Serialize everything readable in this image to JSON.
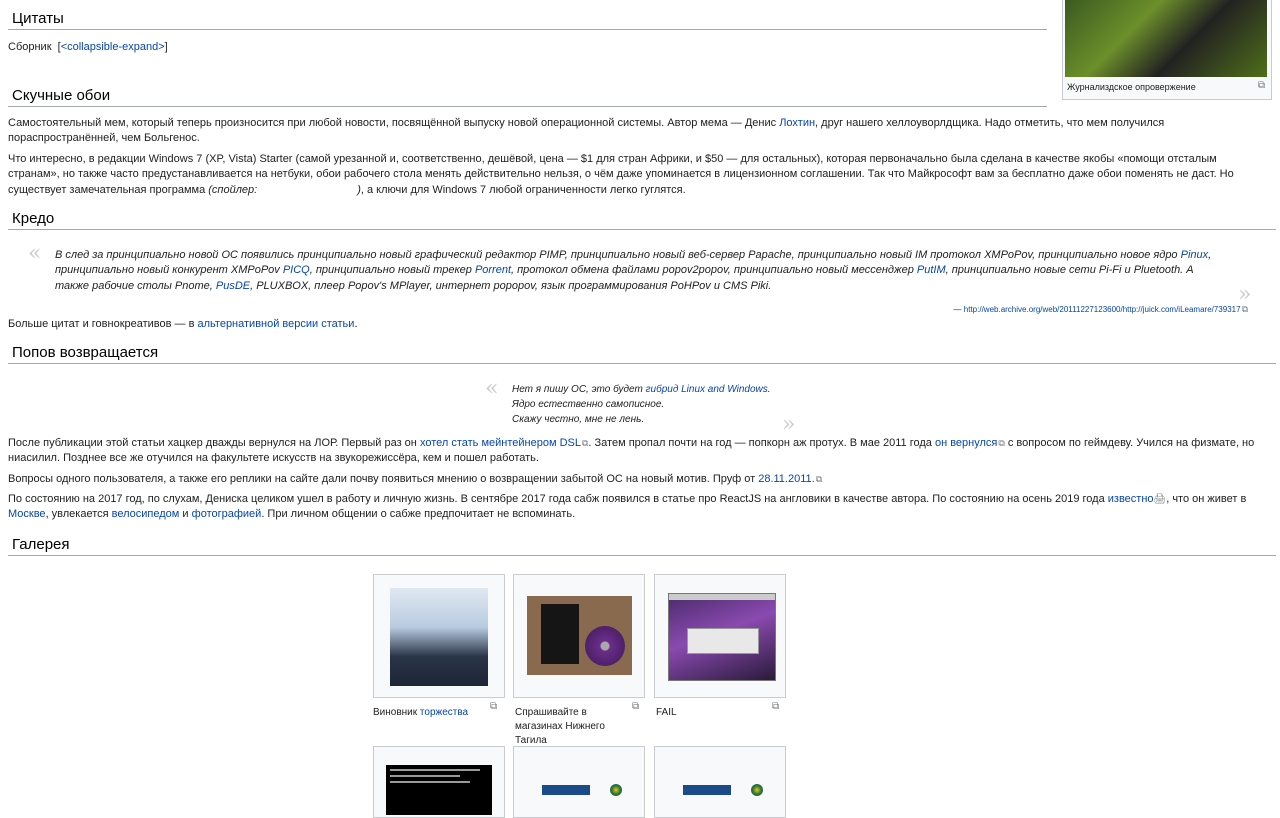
{
  "top_thumb": {
    "caption": "Журнализдское опровержение"
  },
  "sections": {
    "quotes": {
      "title": "Цитаты",
      "collection_label": "Сборник",
      "expand_link": "<collapsible-expand>"
    },
    "boring_wallpapers": {
      "title": "Скучные обои",
      "p1_a": "Самостоятельный мем, который теперь произносится при любой новости, посвящённой выпуску новой операционной системы. Автор мема — Денис ",
      "p1_link": "Лохтин",
      "p1_b": ", друг нашего хеллоуворлдщика. Надо отметить, что мем получился пораспространённей, чем Больгенос.",
      "p2_a": "Что интересно, в редакции Windows 7 (XP, Vista) Starter (самой урезанной и, соответственно, дешёвой, цена — $1 для стран Африки, и $50 — для остальных), которая первоначально была сделана в качестве якобы «помощи отсталым странам», но также часто предустанавливается на нетбуки, обои рабочего стола менять действительно нельзя, о чём даже упоминается в лицензионном соглашении. Так что Майкрософт вам за бесплатно даже обои поменять не даст. Но существует замечательная программа ",
      "p2_spoiler": "(спойлер:",
      "p2_spoiler_end": ")",
      "p2_b": ", а ключи для Windows 7 любой ограниченности легко гуглятся."
    },
    "credo": {
      "title": "Кредо",
      "q_a": "В след за принципиально новой ОС появились принципиально новый графический редактор PIMP, принципиально новый веб-сервер Papache, принципиально новый IM протокол XMPoPov, принципиально новое ядро ",
      "q_l1": "Pinux",
      "q_b": ", принципиально новый конкурент XMPoPov ",
      "q_l2": "PICQ",
      "q_c": ", принципиально новый трекер ",
      "q_l3": "Porrent",
      "q_d": ", протокол обмена файлами popov2popov, принципиально новый мессенджер ",
      "q_l4": "PutIM",
      "q_e": ", принципиально новые сети Pi-Fi и Pluetooth. А также рабочие столы Pnome, ",
      "q_l5": "PusDE",
      "q_f": ", PLUXBOX, плеер Popov's MPlayer, интернет popopov, язык программирования PoHPov и CMS Piki.",
      "source_dash": "— ",
      "source_link": "http://web.archive.org/web/20111227123600/http://juick.com/iLeamare/739317",
      "more_a": "Больше цитат и говнокреативов — в ",
      "more_link": "альтернативной версии статьи",
      "more_b": "."
    },
    "returns": {
      "title": "Попов возвращается",
      "poem_l1_a": "Нет я пишу ОС, это будет ",
      "poem_l1_link": "гибрид Linux and Windows",
      "poem_l1_b": ".",
      "poem_l2": "Ядро естественно самописное.",
      "poem_l3": "Скажу честно, мне не лень.",
      "p1_a": "После публикации этой статьи хацкер дважды вернулся на ЛОР. Первый раз он ",
      "p1_l1": "хотел стать мейнтейнером DSL",
      "p1_b": " Затем пропал почти на год — попкорн аж протух. В мае 2011 года ",
      "p1_l2": "он вернулся",
      "p1_c": " с вопросом по геймдеву. Учился на физмате, но ниасилил. Позднее все же отучился на факультете искусств на звукорежиссёра, кем и пошел работать.",
      "p2_a": "Вопросы одного пользователя, а также его реплики на сайте дали почву появиться мнению о возвращении забытой ОС на новый мотив. Пруф от ",
      "p2_link": "28.11.2011.",
      "p3_a": "По состоянию на 2017 год, по слухам, Дениска целиком ушел в работу и личную жизнь. В сентябре 2017 года сабж появился в статье про ReactJS на англовики в качестве автора. По состоянию на осень 2019 года ",
      "p3_l1": "известно",
      "p3_b": ", что он живет в ",
      "p3_l2": "Москве",
      "p3_c": ", увлекается ",
      "p3_l3": "велосипедом",
      "p3_d": " и ",
      "p3_l4": "фотографией",
      "p3_e": ". При личном общении о сабже предпочитает не вспоминать."
    },
    "gallery": {
      "title": "Галерея",
      "items": [
        {
          "caption_a": "Виновник ",
          "caption_link": "торжества"
        },
        {
          "caption_a": "Спрашивайте в магазинах Нижнего Тагила",
          "caption_link": ""
        },
        {
          "caption_a": "FAIL",
          "caption_link": ""
        }
      ]
    }
  }
}
